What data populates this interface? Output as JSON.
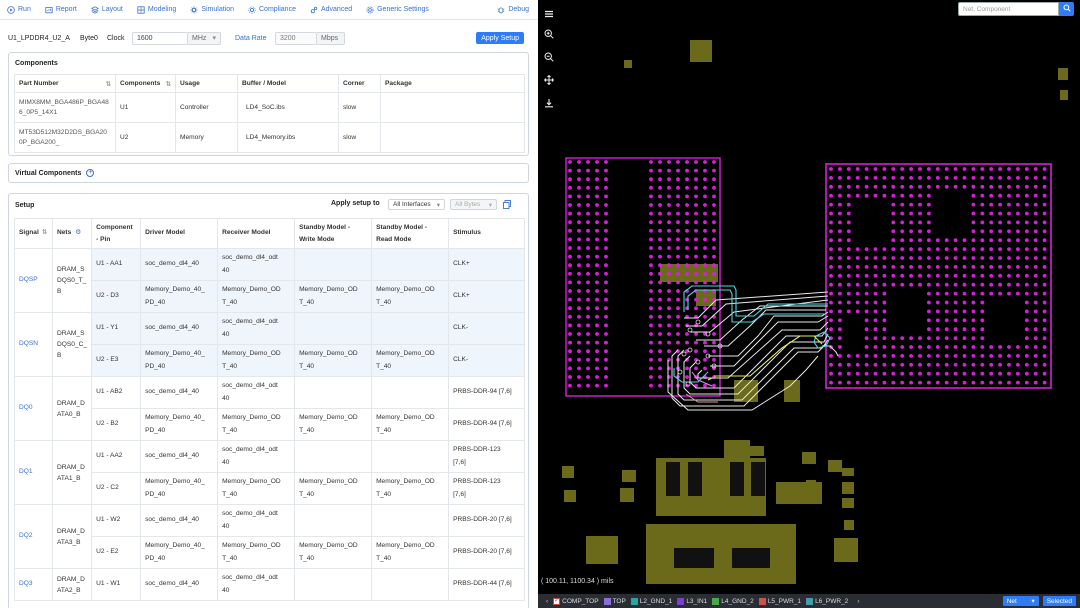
{
  "toolbar": {
    "items": [
      {
        "label": "Run",
        "icon": "play-circle-icon"
      },
      {
        "label": "Report",
        "icon": "report-icon"
      },
      {
        "label": "Layout",
        "icon": "layout-icon"
      },
      {
        "label": "Modeling",
        "icon": "modeling-icon"
      },
      {
        "label": "Simulation",
        "icon": "simulation-icon"
      },
      {
        "label": "Compliance",
        "icon": "compliance-icon"
      },
      {
        "label": "Advanced",
        "icon": "advanced-icon"
      },
      {
        "label": "Generic Settings",
        "icon": "gear-icon"
      }
    ],
    "debug": "Debug"
  },
  "header": {
    "interface": "U1_LPDDR4_U2_A",
    "byte": "Byte0",
    "clock_label": "Clock",
    "clock_value": "1600",
    "clock_unit": "MHz",
    "datarate_label": "Data Rate",
    "datarate_value": "3200",
    "datarate_unit": "Mbps",
    "apply_button": "Apply Setup"
  },
  "components": {
    "title": "Components",
    "columns": [
      "Part Number",
      "Components",
      "Usage",
      "Buffer / Model",
      "Corner",
      "Package"
    ],
    "rows": [
      {
        "part": "MIMX8MM_BGA486P_BGA486_0P5_14X1",
        "part_l1": "MIMX8MM_BGA486P_BGA48",
        "part_l2": "6_0P5_14X1",
        "comp": "U1",
        "usage": "Controller",
        "model": "LD4_SoC.ibs",
        "corner": "slow",
        "package": ""
      },
      {
        "part": "MT53D512M32D2DS_BGA200P_BGA200_",
        "part_l1": "MT53D512M32D2DS_BGA20",
        "part_l2": "0P_BGA200_",
        "comp": "U2",
        "usage": "Memory",
        "model": "LD4_Memory.ibs",
        "corner": "slow",
        "package": ""
      }
    ]
  },
  "virtual": {
    "title": "Virtual Components"
  },
  "setup": {
    "title": "Setup",
    "apply_to_label": "Apply setup to",
    "apply_to_value": "All Interfaces",
    "bytes_value": "All Bytes",
    "columns": {
      "signal": "Signal",
      "nets": "Nets",
      "pin_l1": "Component",
      "pin_l2": "- Pin",
      "driver": "Driver Model",
      "receiver": "Receiver Model",
      "sw_l1": "Standby Model -",
      "sw_l2": "Write Mode",
      "sr_l1": "Standby Model -",
      "sr_l2": "Read Mode",
      "stimulus": "Stimulus"
    },
    "groups": [
      {
        "signal": "DQSP",
        "net_l1": "DRAM_S",
        "net_l2": "DQS0_T_",
        "net_l3": "B",
        "hl": true,
        "rows": [
          {
            "pin": "U1 - AA1",
            "drv": "soc_demo_dl4_40",
            "rcv_l1": "soc_demo_dl4_odt",
            "rcv_l2": "40",
            "sw_l1": "",
            "sw_l2": "",
            "sr_l1": "",
            "sr_l2": "",
            "stim_l1": "CLK+",
            "stim_l2": ""
          },
          {
            "pin": "U2 - D3",
            "drv_l1": "Memory_Demo_40_",
            "drv_l2": "PD_40",
            "rcv_l1": "Memory_Demo_OD",
            "rcv_l2": "T_40",
            "sw_l1": "Memory_Demo_OD",
            "sw_l2": "T_40",
            "sr_l1": "Memory_Demo_OD",
            "sr_l2": "T_40",
            "stim_l1": "CLK+",
            "stim_l2": ""
          }
        ]
      },
      {
        "signal": "DQSN",
        "net_l1": "DRAM_S",
        "net_l2": "DQS0_C_",
        "net_l3": "B",
        "hl": true,
        "rows": [
          {
            "pin": "U1 - Y1",
            "drv": "soc_demo_dl4_40",
            "rcv_l1": "soc_demo_dl4_odt",
            "rcv_l2": "40",
            "sw_l1": "",
            "sw_l2": "",
            "sr_l1": "",
            "sr_l2": "",
            "stim_l1": "CLK-",
            "stim_l2": ""
          },
          {
            "pin": "U2 - E3",
            "drv_l1": "Memory_Demo_40_",
            "drv_l2": "PD_40",
            "rcv_l1": "Memory_Demo_OD",
            "rcv_l2": "T_40",
            "sw_l1": "Memory_Demo_OD",
            "sw_l2": "T_40",
            "sr_l1": "Memory_Demo_OD",
            "sr_l2": "T_40",
            "stim_l1": "CLK-",
            "stim_l2": ""
          }
        ]
      },
      {
        "signal": "DQ0",
        "net_l1": "DRAM_D",
        "net_l2": "ATA0_B",
        "net_l3": "",
        "hl": false,
        "rows": [
          {
            "pin": "U1 - AB2",
            "drv": "soc_demo_dl4_40",
            "rcv_l1": "soc_demo_dl4_odt",
            "rcv_l2": "40",
            "sw_l1": "",
            "sw_l2": "",
            "sr_l1": "",
            "sr_l2": "",
            "stim_l1": "PRBS-DDR-94 [7,6]",
            "stim_l2": ""
          },
          {
            "pin": "U2 - B2",
            "drv_l1": "Memory_Demo_40_",
            "drv_l2": "PD_40",
            "rcv_l1": "Memory_Demo_OD",
            "rcv_l2": "T_40",
            "sw_l1": "Memory_Demo_OD",
            "sw_l2": "T_40",
            "sr_l1": "Memory_Demo_OD",
            "sr_l2": "T_40",
            "stim_l1": "PRBS-DDR-94 [7,6]",
            "stim_l2": ""
          }
        ]
      },
      {
        "signal": "DQ1",
        "net_l1": "DRAM_D",
        "net_l2": "ATA1_B",
        "net_l3": "",
        "hl": false,
        "rows": [
          {
            "pin": "U1 - AA2",
            "drv": "soc_demo_dl4_40",
            "rcv_l1": "soc_demo_dl4_odt",
            "rcv_l2": "40",
            "sw_l1": "",
            "sw_l2": "",
            "sr_l1": "",
            "sr_l2": "",
            "stim_l1": "PRBS-DDR-123",
            "stim_l2": "[7,6]"
          },
          {
            "pin": "U2 - C2",
            "drv_l1": "Memory_Demo_40_",
            "drv_l2": "PD_40",
            "rcv_l1": "Memory_Demo_OD",
            "rcv_l2": "T_40",
            "sw_l1": "Memory_Demo_OD",
            "sw_l2": "T_40",
            "sr_l1": "Memory_Demo_OD",
            "sr_l2": "T_40",
            "stim_l1": "PRBS-DDR-123",
            "stim_l2": "[7,6]"
          }
        ]
      },
      {
        "signal": "DQ2",
        "net_l1": "DRAM_D",
        "net_l2": "ATA3_B",
        "net_l3": "",
        "hl": false,
        "rows": [
          {
            "pin": "U1 - W2",
            "drv": "soc_demo_dl4_40",
            "rcv_l1": "soc_demo_dl4_odt",
            "rcv_l2": "40",
            "sw_l1": "",
            "sw_l2": "",
            "sr_l1": "",
            "sr_l2": "",
            "stim_l1": "PRBS-DDR-20 [7,6]",
            "stim_l2": ""
          },
          {
            "pin": "U2 - E2",
            "drv_l1": "Memory_Demo_40_",
            "drv_l2": "PD_40",
            "rcv_l1": "Memory_Demo_OD",
            "rcv_l2": "T_40",
            "sw_l1": "Memory_Demo_OD",
            "sw_l2": "T_40",
            "sr_l1": "Memory_Demo_OD",
            "sr_l2": "T_40",
            "stim_l1": "PRBS-DDR-20 [7,6]",
            "stim_l2": ""
          }
        ]
      },
      {
        "signal": "DQ3",
        "net_l1": "DRAM_D",
        "net_l2": "ATA2_B",
        "net_l3": "",
        "hl": false,
        "rows": [
          {
            "pin": "U1 - W1",
            "drv": "soc_demo_dl4_40",
            "rcv_l1": "soc_demo_dl4_odt",
            "rcv_l2": "40",
            "sw_l1": "",
            "sw_l2": "",
            "sr_l1": "",
            "sr_l2": "",
            "stim_l1": "PRBS-DDR-44 [7,6]",
            "stim_l2": ""
          }
        ]
      }
    ]
  },
  "layout_view": {
    "search_placeholder": "Net, Component",
    "coords": "( 100.11, 1100.34 ) mils",
    "layers": [
      {
        "name": "COMP_TOP",
        "color": "#d04040",
        "checked": true
      },
      {
        "name": "TOP",
        "color": "#8a6fd8",
        "checked": false
      },
      {
        "name": "L2_GND_1",
        "color": "#2aa3a3",
        "checked": false
      },
      {
        "name": "L3_IN1",
        "color": "#7a3fd0",
        "checked": false
      },
      {
        "name": "L4_GND_2",
        "color": "#4aa84a",
        "checked": false
      },
      {
        "name": "L5_PWR_1",
        "color": "#d05050",
        "checked": false
      },
      {
        "name": "L6_PWR_2",
        "color": "#4a9aa8",
        "checked": false
      }
    ],
    "net_select": "Net",
    "selected_button": "Selected",
    "colors": {
      "pad": "#6a6a1a",
      "chip": "#d81ed8",
      "trace_white": "#e8e8e8",
      "trace_cyan": "#4ad8e0",
      "trace_yellow": "#e8e860"
    }
  }
}
